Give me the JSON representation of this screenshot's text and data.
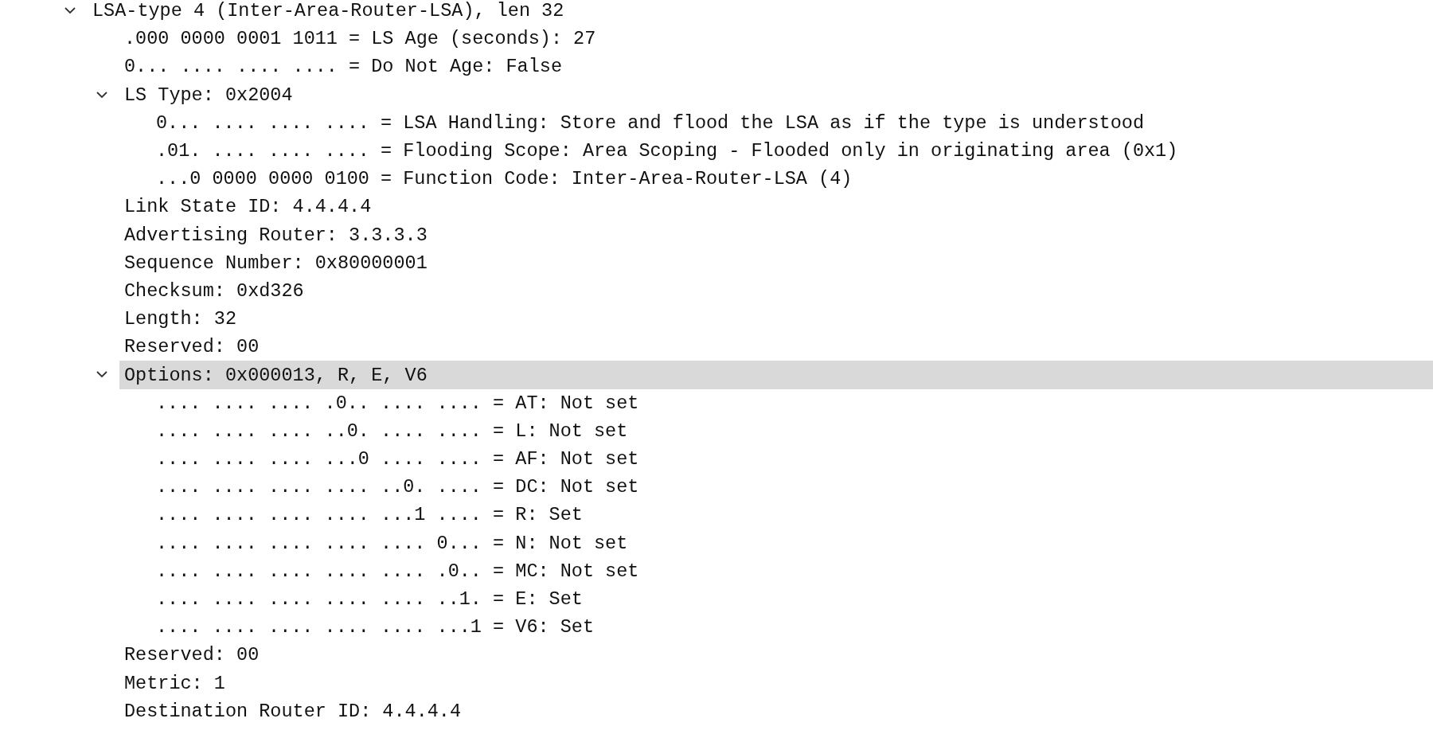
{
  "tree": [
    {
      "text": "LSA-type 4 (Inter-Area-Router-LSA), len 32",
      "expanded": true,
      "selected": false,
      "children": [
        {
          "text": ".000 0000 0001 1011 = LS Age (seconds): 27",
          "selected": false
        },
        {
          "text": "0... .... .... .... = Do Not Age: False",
          "selected": false
        },
        {
          "text": "LS Type: 0x2004",
          "expanded": true,
          "selected": false,
          "children": [
            {
              "text": "0... .... .... .... = LSA Handling: Store and flood the LSA as if the type is understood",
              "selected": false
            },
            {
              "text": ".01. .... .... .... = Flooding Scope: Area Scoping - Flooded only in originating area (0x1)",
              "selected": false
            },
            {
              "text": "...0 0000 0000 0100 = Function Code: Inter-Area-Router-LSA (4)",
              "selected": false
            }
          ]
        },
        {
          "text": "Link State ID: 4.4.4.4",
          "selected": false
        },
        {
          "text": "Advertising Router: 3.3.3.3",
          "selected": false
        },
        {
          "text": "Sequence Number: 0x80000001",
          "selected": false
        },
        {
          "text": "Checksum: 0xd326",
          "selected": false
        },
        {
          "text": "Length: 32",
          "selected": false
        },
        {
          "text": "Reserved: 00",
          "selected": false
        },
        {
          "text": "Options: 0x000013, R, E, V6",
          "expanded": true,
          "selected": true,
          "children": [
            {
              "text": ".... .... .... .0.. .... .... = AT: Not set",
              "selected": false
            },
            {
              "text": ".... .... .... ..0. .... .... = L: Not set",
              "selected": false
            },
            {
              "text": ".... .... .... ...0 .... .... = AF: Not set",
              "selected": false
            },
            {
              "text": ".... .... .... .... ..0. .... = DC: Not set",
              "selected": false
            },
            {
              "text": ".... .... .... .... ...1 .... = R: Set",
              "selected": false
            },
            {
              "text": ".... .... .... .... .... 0... = N: Not set",
              "selected": false
            },
            {
              "text": ".... .... .... .... .... .0.. = MC: Not set",
              "selected": false
            },
            {
              "text": ".... .... .... .... .... ..1. = E: Set",
              "selected": false
            },
            {
              "text": ".... .... .... .... .... ...1 = V6: Set",
              "selected": false
            }
          ]
        },
        {
          "text": "Reserved: 00",
          "selected": false
        },
        {
          "text": "Metric: 1",
          "selected": false
        },
        {
          "text": "Destination Router ID: 4.4.4.4",
          "selected": false
        }
      ]
    }
  ]
}
